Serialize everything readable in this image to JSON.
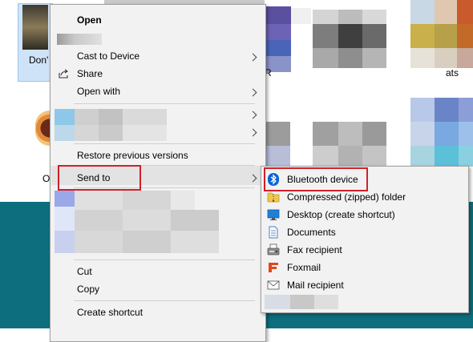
{
  "desktop_labels": {
    "file_left_top": "Don'",
    "file_left_bottom": "O",
    "file_mid": "R",
    "file_right": "ats"
  },
  "context_menu": {
    "items": [
      {
        "label": "Open",
        "bold": true
      },
      {
        "label": "Cast to Device",
        "submenu": true
      },
      {
        "label": "Share",
        "icon": "share-icon"
      },
      {
        "label": "Open with",
        "submenu": true
      },
      {
        "label": "Restore previous versions"
      },
      {
        "label": "Send to",
        "submenu": true,
        "highlighted": true
      },
      {
        "label": "Cut"
      },
      {
        "label": "Copy"
      },
      {
        "label": "Create shortcut"
      }
    ]
  },
  "send_to_menu": {
    "items": [
      {
        "label": "Bluetooth device",
        "icon": "bluetooth-icon",
        "highlighted": true
      },
      {
        "label": "Compressed (zipped) folder",
        "icon": "zip-folder-icon"
      },
      {
        "label": "Desktop (create shortcut)",
        "icon": "desktop-icon"
      },
      {
        "label": "Documents",
        "icon": "documents-icon"
      },
      {
        "label": "Fax recipient",
        "icon": "fax-icon"
      },
      {
        "label": "Foxmail",
        "icon": "foxmail-icon"
      },
      {
        "label": "Mail recipient",
        "icon": "mail-icon"
      }
    ]
  },
  "colors": {
    "highlight_box": "#d3202a",
    "menu_bg": "#f2f2f2",
    "desktop_teal": "#0d6e7d",
    "bluetooth_blue": "#0a64d8",
    "foxmail_red": "#e2471b"
  }
}
